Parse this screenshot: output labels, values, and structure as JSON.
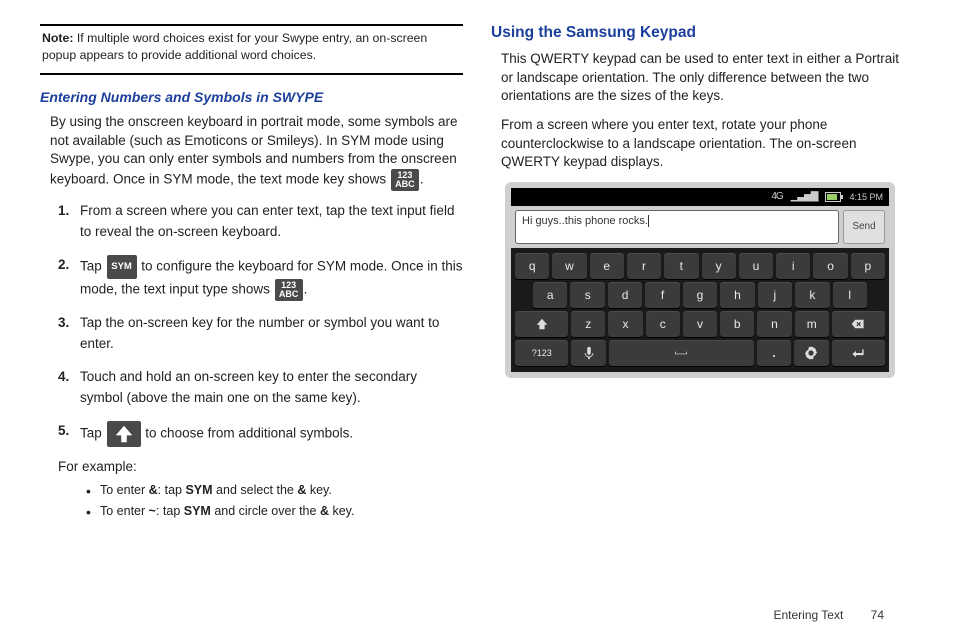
{
  "note": {
    "label": "Note:",
    "text": "If multiple word choices exist for your Swype entry, an on-screen popup appears to provide additional word choices."
  },
  "left": {
    "heading_swype": "Entering Numbers and Symbols in SWYPE",
    "intro_a": "By using the onscreen keyboard in portrait mode, some symbols are not available (such as Emoticons or Smileys). In SYM mode using Swype, you can only enter symbols and numbers from the onscreen keyboard. Once in SYM mode, the text mode key shows ",
    "intro_b": ".",
    "kbd_123": "123",
    "kbd_abc": "ABC",
    "kbd_sym": "SYM",
    "steps": {
      "s1": "From a screen where you can enter text, tap the text input field to reveal the on-screen keyboard.",
      "s2a": "Tap ",
      "s2b": " to configure the keyboard for SYM mode. Once in this mode, the text input type shows ",
      "s2c": ".",
      "s3": "Tap the on-screen key for the number or symbol you want to enter.",
      "s4": "Touch and hold an on-screen key to enter the secondary symbol (above the main one on the same key).",
      "s5a": "Tap ",
      "s5b": " to choose from additional symbols."
    },
    "for_example": "For example:",
    "ex1a": "To enter ",
    "ex1_sym": "&",
    "ex1b": ": tap ",
    "ex1_sym_lbl": "SYM",
    "ex1c": " and select the ",
    "ex1d": " key.",
    "ex2a": "To enter ",
    "ex2_sym": "~",
    "ex2b": ": tap ",
    "ex2c": " and circle over the ",
    "ex2d": " key."
  },
  "right": {
    "heading": "Using the Samsung Keypad",
    "p1": "This QWERTY keypad can be used to enter text in either a Portrait or landscape orientation. The only difference between the two orientations are the sizes of the keys.",
    "p2": "From a screen where you enter text, rotate your phone counterclockwise to a landscape orientation. The on-screen QWERTY keypad displays."
  },
  "phone": {
    "status": {
      "lte": "4G",
      "time": "4:15 PM"
    },
    "text": "Hi guys..this phone rocks.",
    "send": "Send",
    "rows": {
      "r1": [
        "q",
        "w",
        "e",
        "r",
        "t",
        "y",
        "u",
        "i",
        "o",
        "p"
      ],
      "r2": [
        "a",
        "s",
        "d",
        "f",
        "g",
        "h",
        "j",
        "k",
        "l"
      ],
      "r3_mid": [
        "z",
        "x",
        "c",
        "v",
        "b",
        "n",
        "m"
      ],
      "sym_key": "?123"
    }
  },
  "footer": {
    "section": "Entering Text",
    "page": "74"
  }
}
